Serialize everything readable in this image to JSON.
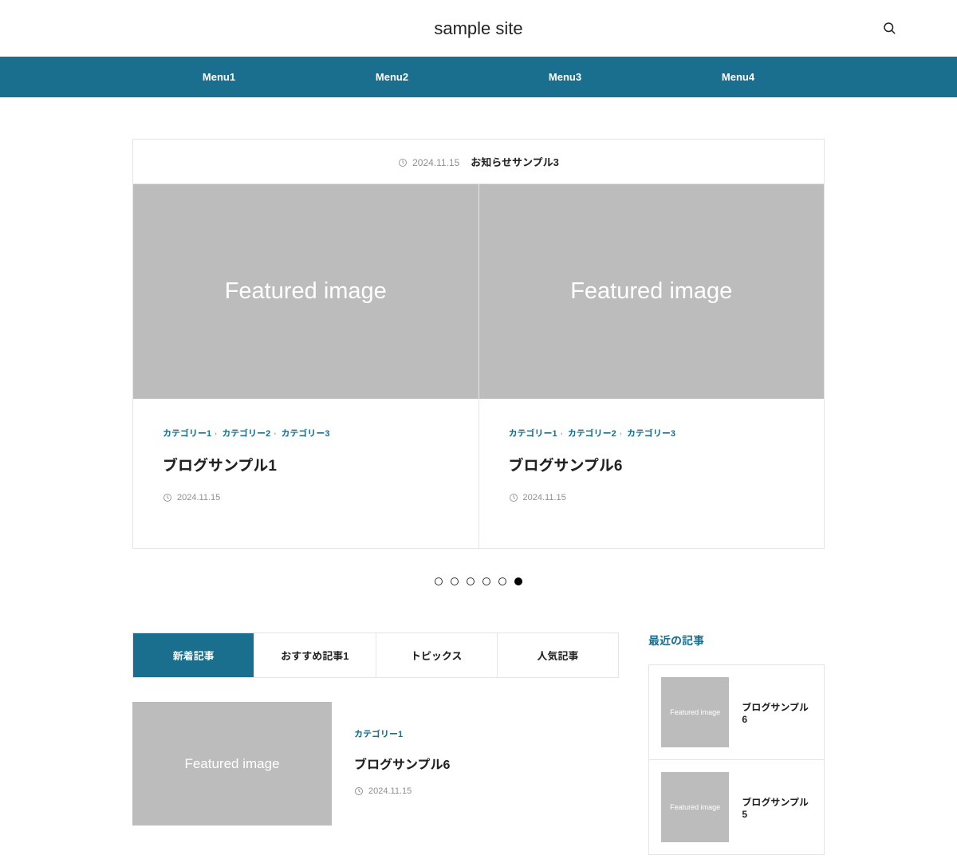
{
  "site_title": "sample site",
  "nav": [
    "Menu1",
    "Menu2",
    "Menu3",
    "Menu4"
  ],
  "info": {
    "date": "2024.11.15",
    "title": "お知らせサンプル3"
  },
  "slides": [
    {
      "image_text": "Featured image",
      "categories": [
        "カテゴリー1",
        "カテゴリー2",
        "カテゴリー3"
      ],
      "title": "ブログサンプル1",
      "date": "2024.11.15"
    },
    {
      "image_text": "Featured image",
      "categories": [
        "カテゴリー1",
        "カテゴリー2",
        "カテゴリー3"
      ],
      "title": "ブログサンプル6",
      "date": "2024.11.15"
    }
  ],
  "bullet_count": 6,
  "active_bullet_index": 5,
  "tabs": [
    "新着記事",
    "おすすめ記事1",
    "トピックス",
    "人気記事"
  ],
  "active_tab_index": 0,
  "post": {
    "image_text": "Featured image",
    "category": "カテゴリー1",
    "title": "ブログサンプル6",
    "date": "2024.11.15"
  },
  "sidebar": {
    "heading": "最近の記事",
    "items": [
      {
        "thumb_text": "Featured image",
        "title": "ブログサンプル6"
      },
      {
        "thumb_text": "Featured image",
        "title": "ブログサンプル5"
      }
    ]
  }
}
